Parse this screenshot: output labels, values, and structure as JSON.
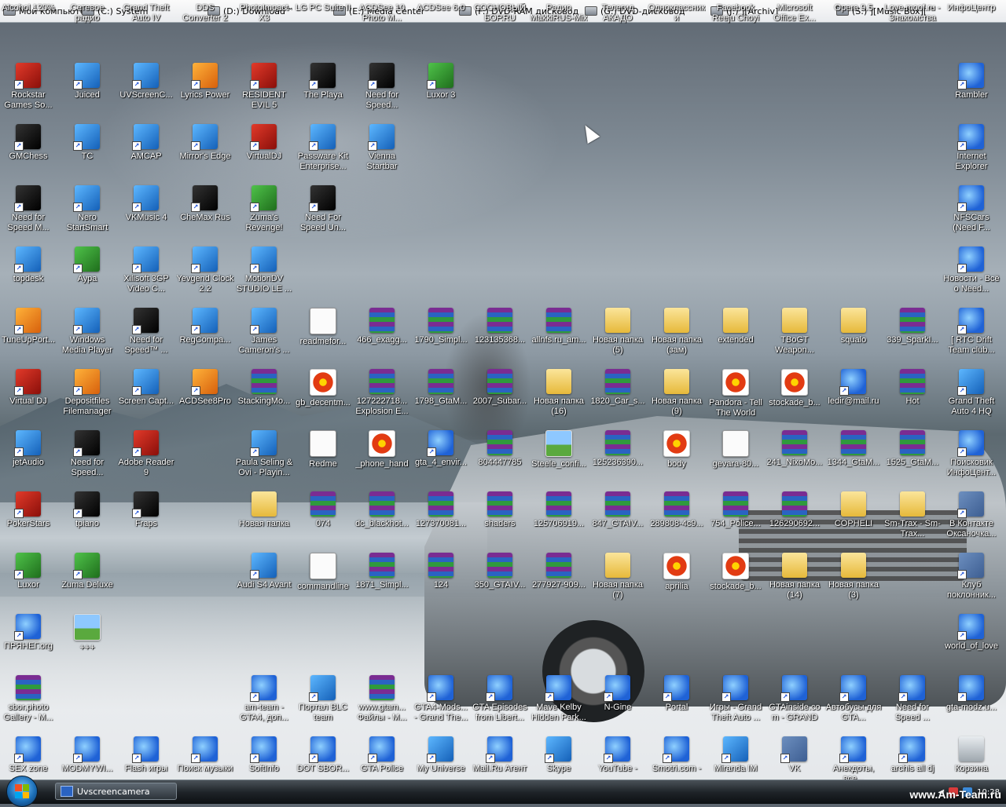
{
  "top_bar": {
    "drives": [
      {
        "label": "Мой компьютер",
        "icon": "my-computer-icon"
      },
      {
        "label": "(C:) System",
        "icon": "drive-icon"
      },
      {
        "label": "(D:) Download™",
        "icon": "drive-icon"
      },
      {
        "label": "(E:) Media Center",
        "icon": "drive-icon"
      },
      {
        "label": "(F:) DVD-RAM дисковод",
        "icon": "dvd-drive-icon"
      },
      {
        "label": "(G:) DVD-дисковод",
        "icon": "dvd-drive-icon"
      },
      {
        "label": "(J:) ][Archiv]",
        "icon": "drive-icon"
      },
      {
        "label": "(S:) ][Music Box][™",
        "icon": "drive-icon"
      }
    ]
  },
  "icons": {
    "row0": [
      "Alcohol 120%",
      "Сетевое радио",
      "Grand Theft Auto IV",
      "DDS Converter 2",
      "PhotoImpact X3",
      "LG PC Suite II",
      "ACDSee 10 Photo M...",
      "ACDSee 6.0",
      "СОСНОВЫЙ БОР.RU",
      "Радио MakkiRUS-Mix",
      "Телегид АКАДО",
      "Одноклассники",
      "Facebook Reeju Choyi",
      "Microsoft Office Ex...",
      "Opera 9.5",
      "Love.moof.ru - Знакомства",
      "ИнфоЦентр"
    ],
    "row1": [
      "Rockstar Games So...",
      "Juiced",
      "UVScreenC...",
      "Lyrics Power",
      "RESIDENT EVIL 5",
      "The Playa",
      "Need for Speed...",
      "Luxor 3",
      "Rambler"
    ],
    "row2": [
      "GMChess",
      "TC",
      "AMCAP",
      "Mirror's Edge",
      "VirtualDJ",
      "Passware Kit Enterprise...",
      "Vienna Startbar",
      "Internet Explorer"
    ],
    "row3": [
      "Need for Speed M...",
      "Nero StartSmart",
      "VKMusic 4",
      "CheMax Rus",
      "Zuma's Revenge!",
      "Need For Speed Un...",
      "NFSCars (Need F..."
    ],
    "row4": [
      "topdesk",
      "Аура",
      "Xilisoft 3GP Video C...",
      "Yevgend Clock 2.2",
      "MotionDV STUDIO LE ...",
      "Новости - Всё о Need..."
    ],
    "row5": [
      "TuneUpPort...",
      "Windows Media Player",
      "Need for Speed™ ...",
      "RegCompa...",
      "James Cameron's ...",
      "readmefor...",
      "466_exagg...",
      "1790_Simpl...",
      "123135368...",
      "allnfs.ru_am...",
      "Новая папка (5)",
      "Новая папка (зам)",
      "extended",
      "TBoGT Weapon...",
      "squalo",
      "339_SparkI...",
      "[ RTC Drift Team club..."
    ],
    "row6": [
      "Virtual DJ",
      "Depositfiles Filemanager",
      "Screen Capt...",
      "ACDSee8Pro",
      "StackingMo...",
      "gb_decentm...",
      "127222718... Explosion E...",
      "1798_GtaM...",
      "2007_Subar...",
      "Новая папка (16)",
      "1820_Car_s...",
      "Новая папка (9)",
      "Pandora - Tell The World",
      "stockade_b...",
      "ledir@mail.ru",
      "Hot",
      "Grand Theft Auto 4 HQ"
    ],
    "row7": [
      "jetAudio",
      "Need for Speed...",
      "Adobe Reader 9",
      "Paula Seling & Ovi - Playin...",
      "Redme",
      "_phone_hand",
      "gta_4_envir...",
      "804447785",
      "Steele_confi...",
      "125236390...",
      "body",
      "gevara-80...",
      "241_NixoMo...",
      "1344_GtaM...",
      "1525_GtaM...",
      "Поисковик ИнфоЦент..."
    ],
    "row8": [
      "PokerStars",
      "tpiano",
      "Fraps",
      "Новая папка",
      "074",
      "dc_blackhot...",
      "127370081...",
      "shaders",
      "125706919...",
      "847_GTAIV...",
      "289808-4c9...",
      "754_Police...",
      "126290692...",
      "COPHELI",
      "Sm-Trax - Sm-Trax...",
      "В Контакте Оксаночка..."
    ],
    "row9": [
      "Luxor",
      "Zuma Deluxe",
      "Audi S4 Avant",
      "commandline",
      "1871_Simpl...",
      "124",
      "350_GTAIV...",
      "277927-909...",
      "Новая папка (7)",
      "aprilia",
      "stockade_b...",
      "Новая папка (14)",
      "Новая папка (3)",
      "Клуб поклонник..."
    ],
    "row10": [
      "ПРЯНЕГ.org",
      "+++",
      "world_of_love"
    ],
    "row11": [
      "sbor.photo Gallery - M...",
      "am-team - GTA4, доп...",
      "Портал BLC team",
      "www.gtam... Файлы - М...",
      "GTA4-Mods... - Grand The...",
      "GTA Episodes from Libert...",
      "Mave Kelby Hidden Park...",
      "N-Gine",
      "Portal",
      "Игры - Grand Theft Auto ...",
      "GTAinside.com - GRAND TH...",
      "Автобусы для GTA...",
      "Need for Speed ...",
      "gta-modz.u..."
    ],
    "row12": [
      "SEX zone",
      "MODMYWI...",
      "Flash игры",
      "Поиск музыки",
      "SoftInfo",
      "DOT SBOR...",
      "GTA Police",
      "My Universe",
      "Mail.Ru Агент",
      "Skype",
      "YouTube -",
      "Smotri.com -",
      "Miranda IM",
      "VK",
      "Анекдоты, все...",
      "archis all dj",
      "Корзина"
    ]
  },
  "taskbar": {
    "start_label": "Start",
    "active_task": "Uvscreencamera",
    "clock": "10:28"
  },
  "watermark": "www.Am-Team.ru"
}
